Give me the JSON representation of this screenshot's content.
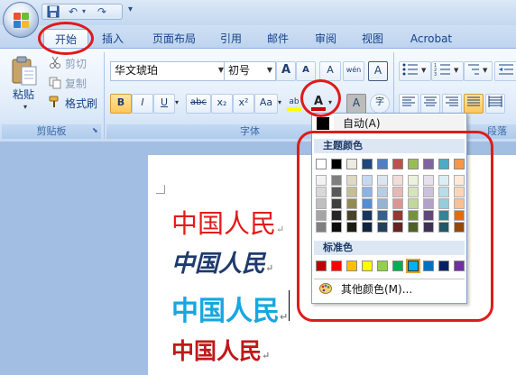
{
  "quick_access": {
    "undo": "↶",
    "redo": "↷",
    "save": "💾",
    "customize": "▾"
  },
  "tabs": [
    "开始",
    "插入",
    "页面布局",
    "引用",
    "邮件",
    "审阅",
    "视图",
    "Acrobat"
  ],
  "clipboard": {
    "paste": "粘贴",
    "cut": "剪切",
    "copy": "复制",
    "format_painter": "格式刷",
    "group_label": "剪贴板"
  },
  "font": {
    "font_name": "华文琥珀",
    "font_size": "初号",
    "group_label": "字体",
    "bold": "B",
    "italic": "I",
    "underline": "U",
    "strike": "abc",
    "subscript": "x₂",
    "superscript": "x²",
    "change_case": "Aa",
    "grow": "A",
    "shrink": "A",
    "clear_format": "A",
    "phonetic": "wén",
    "border_char": "A",
    "shade_char": "A",
    "enclose": "字",
    "font_color_letter": "A",
    "font_color_bar": "#cc0000",
    "highlight_letter": "ab",
    "highlight_color": "#ffff00"
  },
  "paragraph": {
    "group_label": "段落"
  },
  "color_dropdown": {
    "automatic": "自动(A)",
    "automatic_color": "#000000",
    "theme_header": "主题颜色",
    "theme_colors": [
      "#ffffff",
      "#000000",
      "#eeece1",
      "#1f497d",
      "#4f81bd",
      "#c0504d",
      "#9bbb59",
      "#8064a2",
      "#4bacc6",
      "#f79646"
    ],
    "theme_shades": [
      [
        "#f2f2f2",
        "#7f7f7f",
        "#ddd9c3",
        "#c6d9f0",
        "#dbe5f1",
        "#f2dcdb",
        "#ebf1dd",
        "#e5e0ec",
        "#dbeef3",
        "#fdeada"
      ],
      [
        "#d8d8d8",
        "#595959",
        "#c4bd97",
        "#8db3e2",
        "#b8cce4",
        "#e5b9b7",
        "#d7e3bc",
        "#ccc1d9",
        "#b7dde8",
        "#fbd5b5"
      ],
      [
        "#bfbfbf",
        "#3f3f3f",
        "#938953",
        "#548dd4",
        "#95b3d7",
        "#d99694",
        "#c3d69b",
        "#b2a2c7",
        "#92cddc",
        "#fac08f"
      ],
      [
        "#a5a5a5",
        "#262626",
        "#494429",
        "#17365d",
        "#366092",
        "#953734",
        "#76923c",
        "#5f497a",
        "#31859b",
        "#e36c09"
      ],
      [
        "#7f7f7f",
        "#0c0c0c",
        "#1d1b10",
        "#0f243e",
        "#244061",
        "#632423",
        "#4f6128",
        "#3f3151",
        "#205867",
        "#974806"
      ]
    ],
    "standard_header": "标准色",
    "standard_colors": [
      "#c00000",
      "#ff0000",
      "#ffc000",
      "#ffff00",
      "#92d050",
      "#00b050",
      "#00b0f0",
      "#0070c0",
      "#002060",
      "#7030a0"
    ],
    "selected_standard_index": 6,
    "more_colors": "其他颜色(M)..."
  },
  "document": {
    "lines": [
      {
        "text": "中国人民",
        "color": "#e31b1b"
      },
      {
        "text": "中国人民",
        "color": "#1f3a6d"
      },
      {
        "text": "中国人民",
        "color": "#16a7e0"
      },
      {
        "text": "中国人民",
        "color": "#c01818"
      }
    ],
    "paragraph_mark": "↵"
  },
  "annotation_color": "#e01a1a"
}
